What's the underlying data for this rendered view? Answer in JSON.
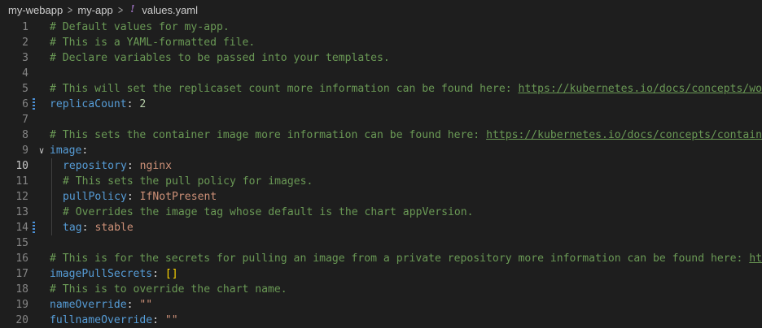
{
  "breadcrumb": {
    "items": [
      "my-webapp",
      "my-app"
    ],
    "file_icon_glyph": "!",
    "file_name": "values.yaml"
  },
  "editor": {
    "active_line": 10,
    "lines": [
      {
        "n": "1",
        "c": "# Default values for my-app."
      },
      {
        "n": "2",
        "c": "# This is a YAML-formatted file."
      },
      {
        "n": "3",
        "c": "# Declare variables to be passed into your templates."
      },
      {
        "n": "4"
      },
      {
        "n": "5",
        "c": "# This will set the replicaset count more information can be found here: ",
        "url": "https://kubernetes.io/docs/concepts/workl"
      },
      {
        "n": "6",
        "k": "replicaCount",
        "v": "2",
        "vt": "num"
      },
      {
        "n": "7"
      },
      {
        "n": "8",
        "c": "# This sets the container image more information can be found here: ",
        "url": "https://kubernetes.io/docs/concepts/containers"
      },
      {
        "n": "9",
        "k": "image"
      },
      {
        "n": "10",
        "k": "repository",
        "v": "nginx",
        "vt": "str"
      },
      {
        "n": "11",
        "c": "# This sets the pull policy for images."
      },
      {
        "n": "12",
        "k": "pullPolicy",
        "v": "IfNotPresent",
        "vt": "str"
      },
      {
        "n": "13",
        "c": "# Overrides the image tag whose default is the chart appVersion."
      },
      {
        "n": "14",
        "k": "tag",
        "v": "stable",
        "vt": "str"
      },
      {
        "n": "15"
      },
      {
        "n": "16",
        "c": "# This is for the secrets for pulling an image from a private repository more information can be found here: ",
        "url": "https"
      },
      {
        "n": "17",
        "k": "imagePullSecrets",
        "v": "[]",
        "vt": "bracket"
      },
      {
        "n": "18",
        "c": "# This is to override the chart name."
      },
      {
        "n": "19",
        "k": "nameOverride",
        "v": "\"\"",
        "vt": "str"
      },
      {
        "n": "20",
        "k": "fullnameOverride",
        "v": "\"\"",
        "vt": "str"
      }
    ]
  }
}
